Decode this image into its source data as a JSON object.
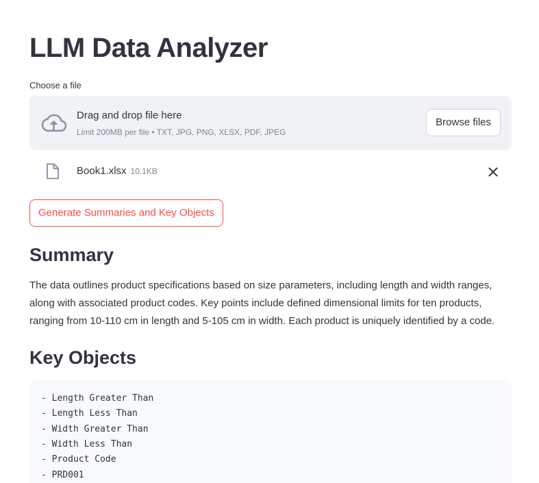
{
  "title": "LLM Data Analyzer",
  "uploader": {
    "label": "Choose a file",
    "drop_title": "Drag and drop file here",
    "drop_subtitle": "Limit 200MB per file • TXT, JPG, PNG, XLSX, PDF, JPEG",
    "browse_label": "Browse files",
    "icon": "cloud-upload-icon"
  },
  "uploaded_file": {
    "name": "Book1.xlsx",
    "size": "10.1KB",
    "icon": "file-icon",
    "remove_icon": "close-icon"
  },
  "generate_button": "Generate Summaries and Key Objects",
  "summary": {
    "heading": "Summary",
    "text": "The data outlines product specifications based on size parameters, including length and width ranges, along with associated product codes. Key points include defined dimensional limits for ten products, ranging from 10-110 cm in length and 5-105 cm in width. Each product is uniquely identified by a code."
  },
  "key_objects": {
    "heading": "Key Objects",
    "lines": [
      "- Length Greater Than",
      "- Length Less Than",
      "- Width Greater Than",
      "- Width Less Than",
      "- Product Code",
      "- PRD001"
    ]
  },
  "colors": {
    "primary": "#ff4b4b",
    "text": "#31333f",
    "muted": "#808495",
    "dropzone_bg": "#f0f2f6",
    "code_bg": "#f8f9fb"
  }
}
